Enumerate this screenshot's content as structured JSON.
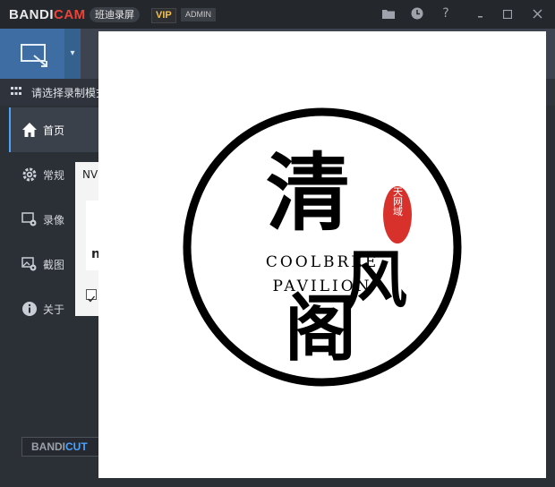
{
  "titlebar": {
    "brand_main": "BANDI",
    "brand_accent": "CAM",
    "product_cn": "班迪录屏",
    "vip": "VIP",
    "admin": "ADMIN"
  },
  "modebar": {
    "label": "请选择录制模式"
  },
  "sidebar": {
    "items": [
      {
        "label": "首页",
        "icon": "home-icon"
      },
      {
        "label": "常规",
        "icon": "gear-icon"
      },
      {
        "label": "录像",
        "icon": "video-gear-icon"
      },
      {
        "label": "截图",
        "icon": "image-gear-icon"
      },
      {
        "label": "关于",
        "icon": "info-icon"
      }
    ],
    "bandicut_main": "BANDI",
    "bandicut_accent": "CUT"
  },
  "panel": {
    "title": "NV",
    "inner_text": "n"
  },
  "logo": {
    "char_1": "清",
    "char_2": "风",
    "char_3": "阁",
    "seal_text": "天网域",
    "line_1": "COOLBREE",
    "line_2": "PAVILION"
  },
  "colors": {
    "accent_red": "#ef4237",
    "accent_blue": "#4aa3ff",
    "mode_blue": "#3d6da3"
  }
}
